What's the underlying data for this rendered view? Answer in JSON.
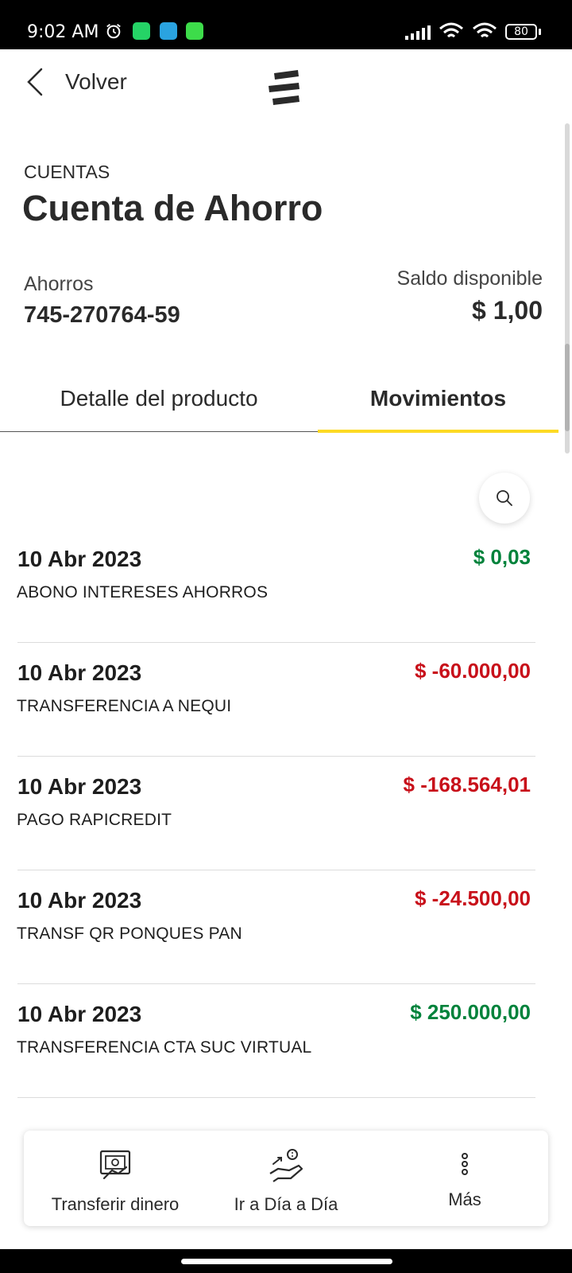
{
  "status_bar": {
    "time": "9:02 AM",
    "battery": "80",
    "icons": [
      "alarm-icon",
      "whatsapp-icon",
      "telegram-icon",
      "android-icon",
      "signal-icon",
      "wifi-icon",
      "wifi-icon",
      "battery-icon"
    ]
  },
  "header": {
    "back_label": "Volver",
    "logo": "bancolombia-logo"
  },
  "account": {
    "section": "CUENTAS",
    "title": "Cuenta de Ahorro",
    "type": "Ahorros",
    "number": "745-270764-59",
    "balance_label": "Saldo disponible",
    "balance": "$ 1,00"
  },
  "tabs": [
    {
      "label": "Detalle del producto",
      "active": false
    },
    {
      "label": "Movimientos",
      "active": true
    }
  ],
  "colors": {
    "accent": "#fdda24",
    "positive": "#00823b",
    "negative": "#c8101a"
  },
  "movements": [
    {
      "date": "10 Abr 2023",
      "description": "ABONO INTERESES AHORROS",
      "amount": "$ 0,03",
      "sign": "positive"
    },
    {
      "date": "10 Abr 2023",
      "description": "TRANSFERENCIA A NEQUI",
      "amount": "$ -60.000,00",
      "sign": "negative"
    },
    {
      "date": "10 Abr 2023",
      "description": "PAGO RAPICREDIT",
      "amount": "$ -168.564,01",
      "sign": "negative"
    },
    {
      "date": "10 Abr 2023",
      "description": "TRANSF QR PONQUES PAN",
      "amount": "$ -24.500,00",
      "sign": "negative"
    },
    {
      "date": "10 Abr 2023",
      "description": "TRANSFERENCIA CTA SUC VIRTUAL",
      "amount": "$ 250.000,00",
      "sign": "positive"
    }
  ],
  "bottom_bar": {
    "transfer_label": "Transferir dinero",
    "dia_label": "Ir a Día a Día",
    "more_label": "Más"
  }
}
